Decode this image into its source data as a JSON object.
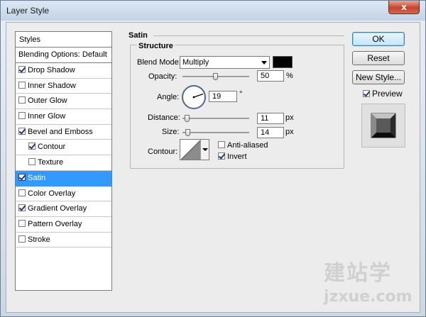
{
  "window": {
    "title": "Layer Style",
    "close_glyph": "x"
  },
  "styles_panel": {
    "header": "Styles",
    "blending_options": "Blending Options: Default",
    "items": [
      {
        "label": "Drop Shadow",
        "checked": true,
        "sub": false,
        "selected": false
      },
      {
        "label": "Inner Shadow",
        "checked": false,
        "sub": false,
        "selected": false
      },
      {
        "label": "Outer Glow",
        "checked": false,
        "sub": false,
        "selected": false
      },
      {
        "label": "Inner Glow",
        "checked": false,
        "sub": false,
        "selected": false
      },
      {
        "label": "Bevel and Emboss",
        "checked": true,
        "sub": false,
        "selected": false
      },
      {
        "label": "Contour",
        "checked": true,
        "sub": true,
        "selected": false
      },
      {
        "label": "Texture",
        "checked": false,
        "sub": true,
        "selected": false
      },
      {
        "label": "Satin",
        "checked": true,
        "sub": false,
        "selected": true
      },
      {
        "label": "Color Overlay",
        "checked": false,
        "sub": false,
        "selected": false
      },
      {
        "label": "Gradient Overlay",
        "checked": true,
        "sub": false,
        "selected": false
      },
      {
        "label": "Pattern Overlay",
        "checked": false,
        "sub": false,
        "selected": false
      },
      {
        "label": "Stroke",
        "checked": false,
        "sub": false,
        "selected": false
      }
    ]
  },
  "satin": {
    "title": "Satin",
    "structure_title": "Structure",
    "blend_mode_label": "Blend Mode:",
    "blend_mode_value": "Multiply",
    "blend_color": "#000000",
    "opacity_label": "Opacity:",
    "opacity_value": "50",
    "opacity_unit": "%",
    "opacity_fraction": 0.5,
    "angle_label": "Angle:",
    "angle_value": "19",
    "angle_unit": "°",
    "distance_label": "Distance:",
    "distance_value": "11",
    "distance_unit": "px",
    "size_label": "Size:",
    "size_value": "14",
    "size_unit": "px",
    "contour_label": "Contour:",
    "anti_aliased_label": "Anti-aliased",
    "anti_aliased_checked": false,
    "invert_label": "Invert",
    "invert_checked": true
  },
  "buttons": {
    "ok": "OK",
    "reset": "Reset",
    "new_style": "New Style...",
    "preview_label": "Preview",
    "preview_checked": true
  },
  "watermark": {
    "brand": "建站学",
    "url": "jzxue.com"
  }
}
